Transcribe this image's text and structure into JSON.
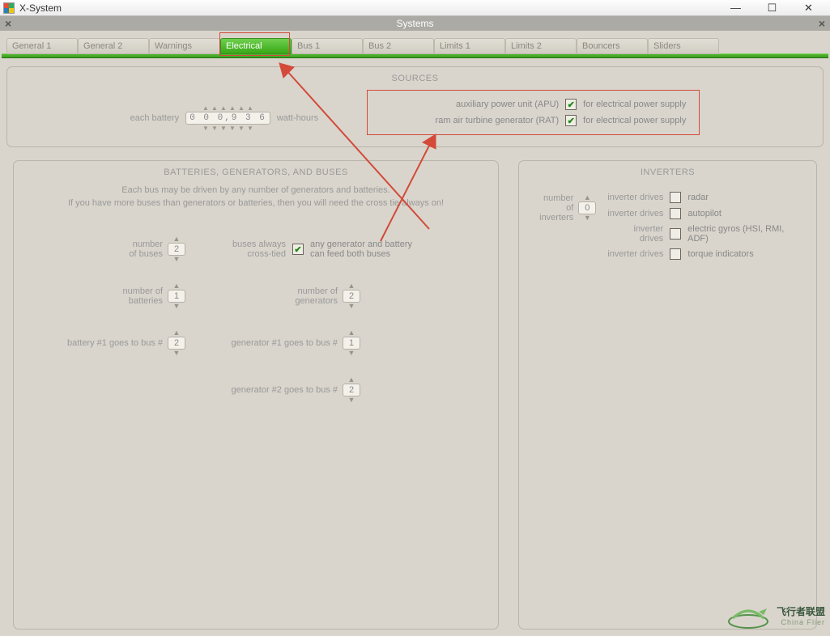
{
  "window": {
    "title": "X-System",
    "subtitle": "Systems"
  },
  "tabs": [
    {
      "label": "General 1",
      "active": false
    },
    {
      "label": "General 2",
      "active": false
    },
    {
      "label": "Warnings",
      "active": false
    },
    {
      "label": "Electrical",
      "active": true
    },
    {
      "label": "Bus 1",
      "active": false
    },
    {
      "label": "Bus 2",
      "active": false
    },
    {
      "label": "Limits 1",
      "active": false
    },
    {
      "label": "Limits 2",
      "active": false
    },
    {
      "label": "Bouncers",
      "active": false
    },
    {
      "label": "Sliders",
      "active": false
    }
  ],
  "sources": {
    "title": "SOURCES",
    "each_battery_label": "each battery",
    "watt_hours_label": "watt-hours",
    "battery_value": "0 0 0,9 3 6",
    "apu": {
      "left": "auxiliary power unit (APU)",
      "right": "for electrical power supply",
      "checked": true
    },
    "rat": {
      "left": "ram air turbine generator (RAT)",
      "right": "for electrical power supply",
      "checked": true
    }
  },
  "batteries": {
    "title": "BATTERIES, GENERATORS, AND BUSES",
    "help1": "Each bus may be driven by any number of generators and batteries.",
    "help2": "If you have more buses than generators or batteries, then you will need the cross tie always on!",
    "num_buses_label": "number\nof buses",
    "num_buses": "2",
    "crosstie_left": "buses always\ncross-tied",
    "crosstie_checked": true,
    "crosstie_right": "any generator and battery\ncan feed both buses",
    "num_batteries_label": "number of\nbatteries",
    "num_batteries": "1",
    "num_generators_label": "number of\ngenerators",
    "num_generators": "2",
    "batt1_label": "battery #1 goes to bus #",
    "batt1_bus": "2",
    "gen1_label": "generator #1 goes to bus #",
    "gen1_bus": "1",
    "gen2_label": "generator #2 goes to bus #",
    "gen2_bus": "2"
  },
  "inverters": {
    "title": "INVERTERS",
    "num_label": "number of\ninverters",
    "num": "0",
    "drives_label": "inverter drives",
    "items": [
      {
        "label": "radar",
        "checked": false
      },
      {
        "label": "autopilot",
        "checked": false
      },
      {
        "label": "electric gyros (HSI, RMI, ADF)",
        "checked": false
      },
      {
        "label": "torque indicators",
        "checked": false
      }
    ]
  },
  "watermark": {
    "cn": "飞行者联盟",
    "en": "China Flier"
  }
}
